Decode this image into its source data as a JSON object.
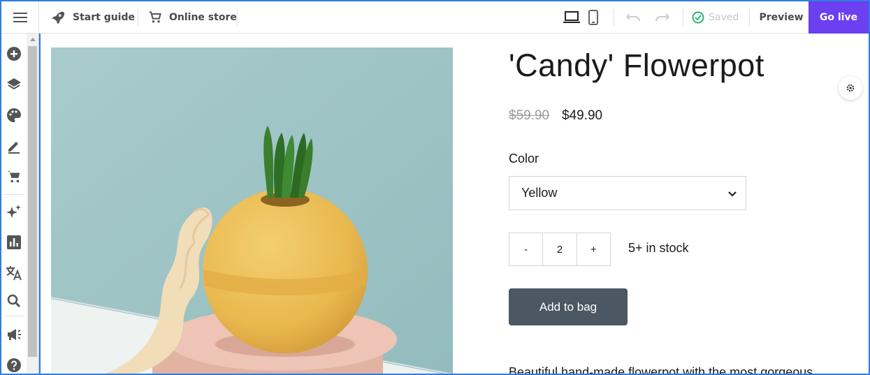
{
  "topbar": {
    "start_guide_label": "Start guide",
    "online_store_label": "Online store",
    "saved_label": "Saved",
    "preview_label": "Preview",
    "go_live_label": "Go live"
  },
  "sidebar": {
    "items": [
      {
        "icon": "add-icon"
      },
      {
        "icon": "layers-icon"
      },
      {
        "icon": "palette-icon"
      },
      {
        "icon": "edit-icon"
      },
      {
        "icon": "cart-icon"
      },
      {
        "icon": "sparkle-icon"
      },
      {
        "icon": "analytics-icon"
      },
      {
        "icon": "translate-icon"
      },
      {
        "icon": "search-icon"
      },
      {
        "icon": "megaphone-icon"
      },
      {
        "icon": "help-icon"
      }
    ]
  },
  "product": {
    "title": "'Candy' Flowerpot",
    "old_price": "$59.90",
    "price": "$49.90",
    "color_label": "Color",
    "color_value": "Yellow",
    "qty_minus": "-",
    "qty_value": "2",
    "qty_plus": "+",
    "stock": "5+ in stock",
    "add_to_bag_label": "Add to bag",
    "description": "Beautiful hand-made flowerpot with the most gorgeous"
  },
  "colors": {
    "accent": "#6c3ff0",
    "frame": "#2f7de1",
    "button": "#4b5763",
    "saved_check": "#2bb673"
  }
}
